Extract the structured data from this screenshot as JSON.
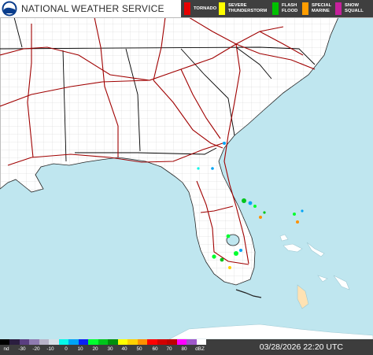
{
  "header": {
    "title": "NATIONAL WEATHER SERVICE",
    "logo_icon": "noaa-logo-icon"
  },
  "legend": [
    {
      "label": "TORNADO",
      "color": "#e60000"
    },
    {
      "label": "SEVERE\nTHUNDERSTORM",
      "color": "#ffff00"
    },
    {
      "label": "FLASH\nFLOOD",
      "color": "#00c000"
    },
    {
      "label": "SPECIAL\nMARINE",
      "color": "#ff9d00"
    },
    {
      "label": "SNOW\nSQUALL",
      "color": "#c6219c"
    }
  ],
  "scale": {
    "labels": [
      "nd",
      "-30",
      "-20",
      "-10",
      "0",
      "10",
      "20",
      "30",
      "40",
      "50",
      "60",
      "70",
      "80",
      "dBZ"
    ],
    "colors": [
      "#000000",
      "#2b1e40",
      "#5a3e80",
      "#8f7bb0",
      "#b9b4c8",
      "#d7dfe6",
      "#06f6e8",
      "#00a3f5",
      "#0a21f5",
      "#00ff2e",
      "#00c51b",
      "#008e0c",
      "#ffff00",
      "#ffd000",
      "#ff9100",
      "#ff0000",
      "#d10000",
      "#bc0000",
      "#ff00ff",
      "#9f58c9",
      "#ffffff"
    ]
  },
  "footer": {
    "timestamp": "03/28/2026 22:20 UTC"
  },
  "colors": {
    "water": "#bfe6ef",
    "land": "#ffffff",
    "highways": "#a00000",
    "state_borders": "#000000",
    "county_lines": "#b3b3b3"
  }
}
